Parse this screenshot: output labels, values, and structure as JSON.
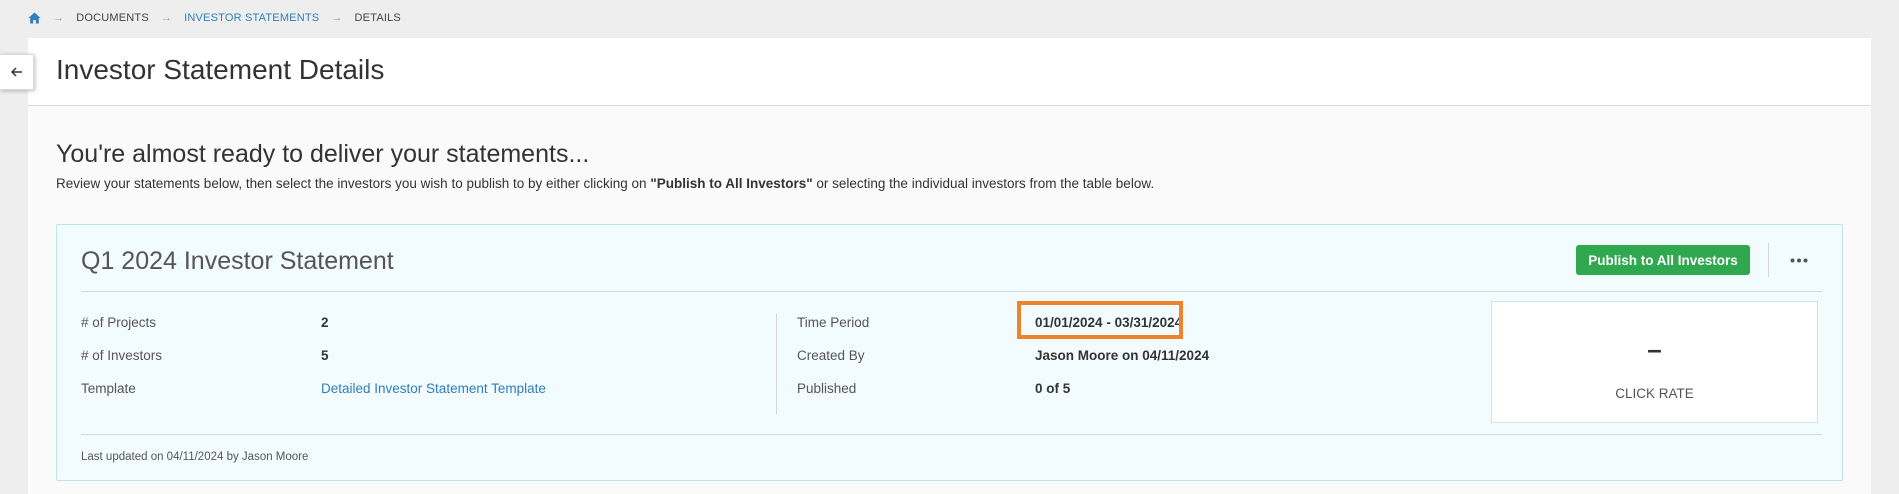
{
  "breadcrumb": {
    "items": [
      {
        "label": "DOCUMENTS"
      },
      {
        "label": "INVESTOR STATEMENTS"
      },
      {
        "label": "DETAILS"
      }
    ]
  },
  "header": {
    "title": "Investor Statement Details"
  },
  "intro": {
    "heading": "You're almost ready to deliver your statements...",
    "text_before": "Review your statements below, then select the investors you wish to publish to by either clicking on ",
    "text_bold": "\"Publish to All Investors\"",
    "text_after": " or selecting the individual investors from the table below."
  },
  "statement": {
    "title": "Q1 2024 Investor Statement",
    "publish_label": "Publish to All Investors",
    "left_fields": [
      {
        "label": "# of Projects",
        "value": "2"
      },
      {
        "label": "# of Investors",
        "value": "5"
      },
      {
        "label": "Template",
        "value": "Detailed Investor Statement Template"
      }
    ],
    "right_fields": [
      {
        "label": "Time Period",
        "value": "01/01/2024 - 03/31/2024"
      },
      {
        "label": "Created By",
        "value": "Jason Moore on 04/11/2024"
      },
      {
        "label": "Published",
        "value": "0 of 5"
      }
    ],
    "click_rate": {
      "value": "–",
      "label": "CLICK RATE"
    },
    "last_updated": "Last updated on 04/11/2024 by Jason Moore"
  },
  "colors": {
    "accent_link": "#2f7fb8",
    "publish_green": "#2fa84f",
    "highlight_orange": "#f0812d",
    "card_background": "#f2fbfd"
  }
}
